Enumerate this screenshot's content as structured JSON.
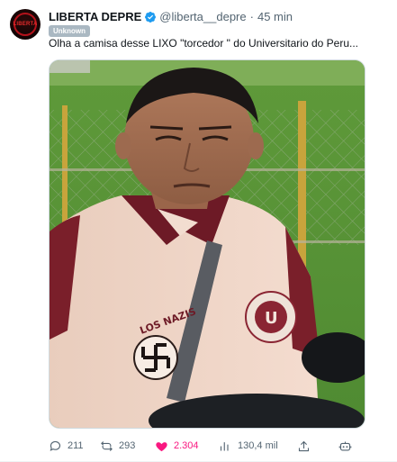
{
  "tweet": {
    "author": {
      "display_name": "LIBERTA DEPRE",
      "handle": "@liberta__depre",
      "separator": "·",
      "time": "45 min",
      "avatar_text": "LIBERTA"
    },
    "badge": "Unknown",
    "text": "Olha a camisa desse LIXO \"torcedor \" do Universitario do Peru...",
    "image_icon": "photo-of-man-in-jersey",
    "shirt_text": "LOS NAZIS",
    "actions": {
      "reply_count": "211",
      "retweet_count": "293",
      "like_count": "2.304",
      "views_count": "130,4 mil"
    }
  },
  "colors": {
    "verified": "#1d9bf0",
    "like": "#f91880",
    "muted": "#536471"
  }
}
